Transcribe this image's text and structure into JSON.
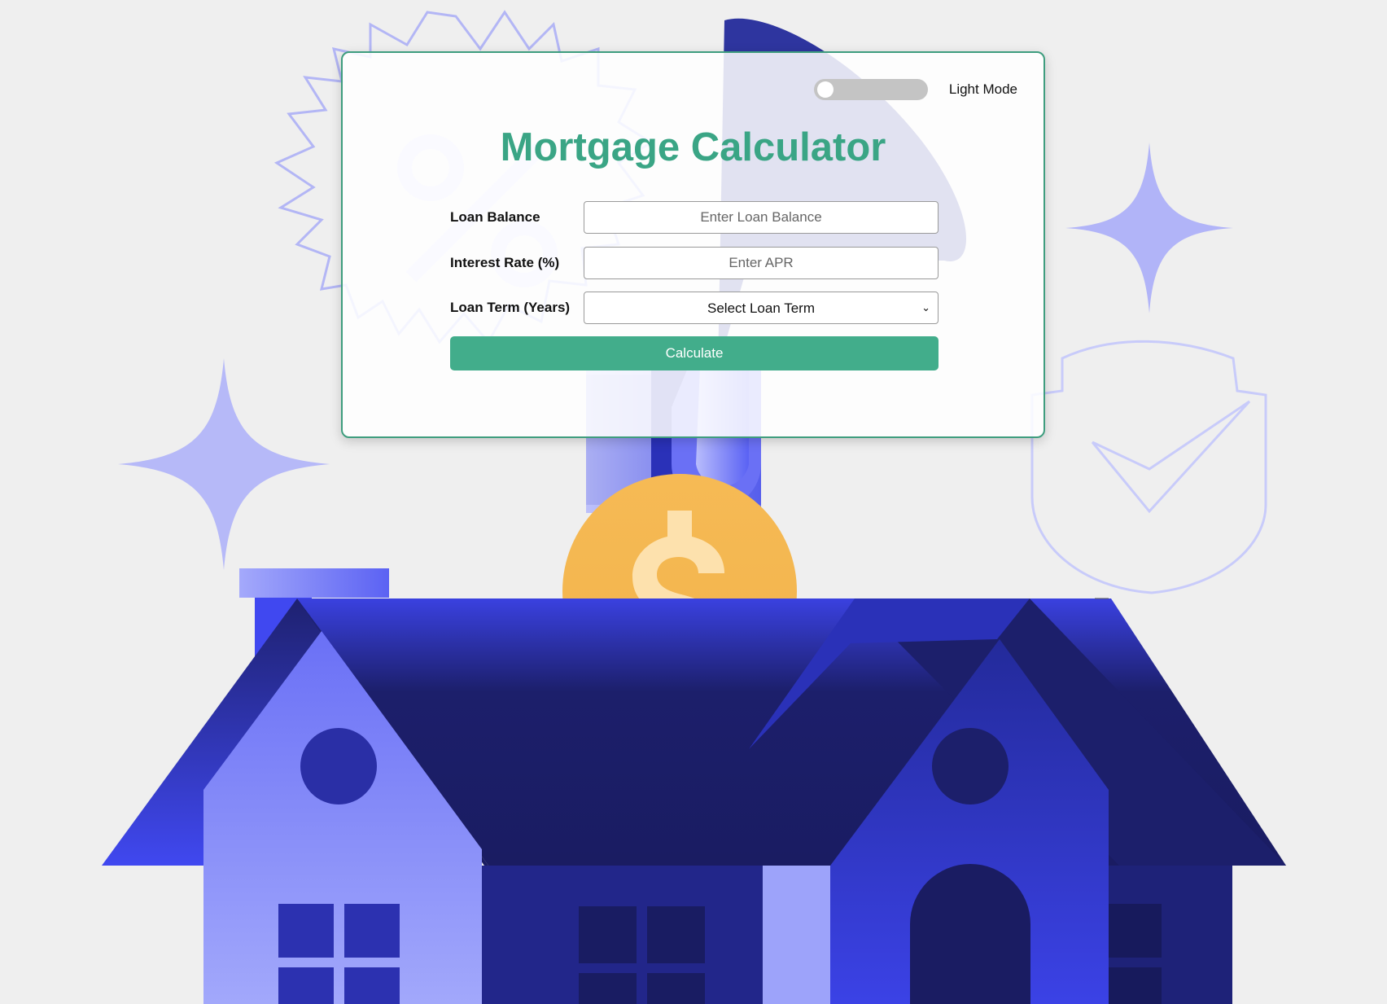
{
  "theme_toggle": {
    "label": "Light Mode",
    "on": false
  },
  "title": "Mortgage Calculator",
  "form": {
    "loan_balance": {
      "label": "Loan Balance",
      "placeholder": "Enter Loan Balance",
      "value": ""
    },
    "interest_rate": {
      "label": "Interest Rate (%)",
      "placeholder": "Enter APR",
      "value": ""
    },
    "loan_term": {
      "label": "Loan Term (Years)",
      "selected": "Select Loan Term"
    },
    "calculate_label": "Calculate"
  },
  "colors": {
    "accent": "#42ad8b",
    "title": "#3aa585",
    "background": "#efefef",
    "house_dark": "#1c1f6b",
    "house_light": "#8f95f8",
    "coin": "#f5b84e"
  },
  "icons": {
    "dollar": "dollar-sign-icon",
    "percent": "percent-icon",
    "shield": "shield-check-icon",
    "sparkle": "sparkle-icon"
  }
}
